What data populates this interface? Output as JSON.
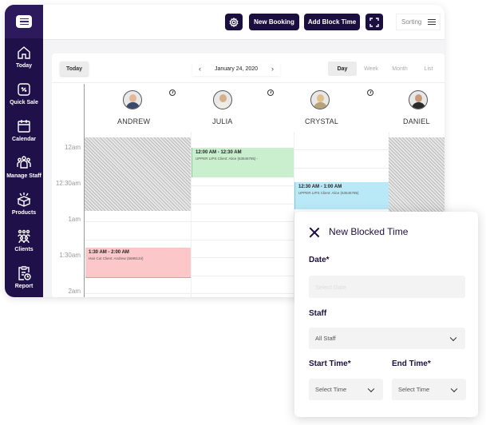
{
  "sidebar": {
    "items": [
      {
        "label": "Today",
        "icon": "home-icon"
      },
      {
        "label": "Quick Sale",
        "icon": "percent-tag-icon"
      },
      {
        "label": "Calendar",
        "icon": "calendar-icon"
      },
      {
        "label": "Manage Staff",
        "icon": "staff-group-icon"
      },
      {
        "label": "Products",
        "icon": "box-icon"
      },
      {
        "label": "Clients",
        "icon": "clients-icon"
      },
      {
        "label": "Report",
        "icon": "report-clipboard-icon"
      }
    ]
  },
  "topbar": {
    "new_booking_label": "New Booking",
    "add_block_time_label": "Add Block Time",
    "sorting_label": "Sorting"
  },
  "calendar": {
    "today_label": "Today",
    "current_date": "January 24, 2020",
    "prev_arrow": "‹",
    "next_arrow": "›",
    "views": [
      {
        "label": "Day",
        "active": true
      },
      {
        "label": "Week",
        "active": false
      },
      {
        "label": "Month",
        "active": false
      },
      {
        "label": "List",
        "active": false
      }
    ],
    "staff": [
      {
        "name": "ANDREW"
      },
      {
        "name": "JULIA"
      },
      {
        "name": "CRYSTAL"
      },
      {
        "name": "DANIEL"
      }
    ],
    "time_labels": [
      "12am",
      "12:30am",
      "1am",
      "1:30am",
      "2am"
    ],
    "events": [
      {
        "staff": "JULIA",
        "time": "12:00 AM - 12:30 AM",
        "desc": "UPPER LIPS Client: Alice (63546785) -",
        "color": "#c9efcf"
      },
      {
        "staff": "CRYSTAL",
        "time": "12:30 AM - 1:00 AM",
        "desc": "UPPER LIPS Client: Alice (63546785)",
        "color": "#b9e9f7"
      },
      {
        "staff": "ANDREW",
        "time": "1:30 AM - 2:00 AM",
        "desc": "Hair Cut Client: Andrew (5689134)",
        "color": "#fbc7c9"
      }
    ]
  },
  "panel": {
    "title": "New Blocked Time",
    "date_label": "Date*",
    "date_placeholder": "Select Date",
    "staff_label": "Staff",
    "staff_value": "All Staff",
    "start_label": "Start Time*",
    "start_value": "Select Time",
    "end_label": "End Time*",
    "end_value": "Select Time"
  }
}
